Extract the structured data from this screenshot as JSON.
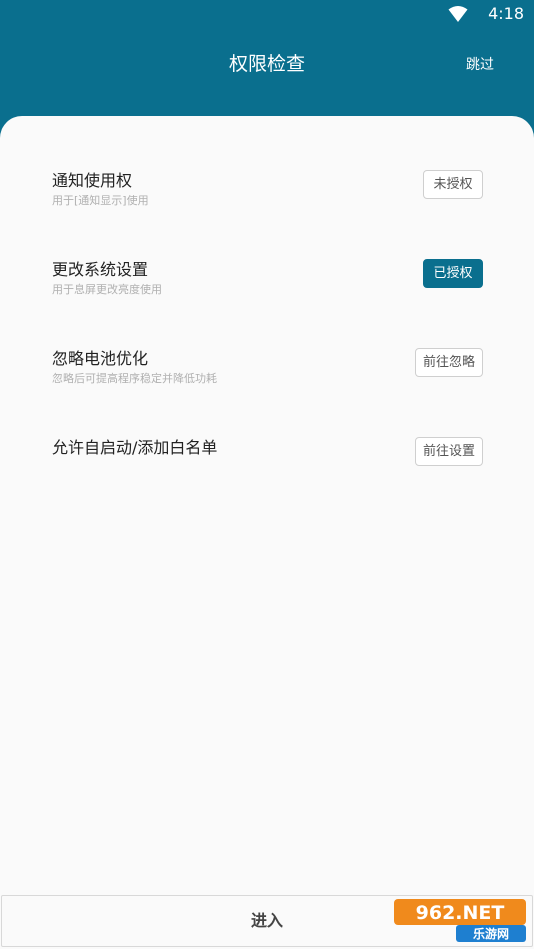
{
  "status_bar": {
    "time": "4:18",
    "wifi_icon": "wifi-icon"
  },
  "header": {
    "title": "权限检查",
    "skip_label": "跳过"
  },
  "permissions": [
    {
      "title": "通知使用权",
      "description": "用于[通知显示]使用",
      "button": "未授权",
      "granted": false
    },
    {
      "title": "更改系统设置",
      "description": "用于息屏更改亮度使用",
      "button": "已授权",
      "granted": true
    },
    {
      "title": "忽略电池优化",
      "description": "忽略后可提高程序稳定并降低功耗",
      "button": "前往忽略",
      "granted": false
    },
    {
      "title": "允许自启动/添加白名单",
      "description": "",
      "button": "前往设置",
      "granted": false
    }
  ],
  "footer": {
    "enter_label": "进入"
  },
  "watermark": {
    "logo_text": "962.NET",
    "site_name": "乐游网"
  },
  "colors": {
    "primary": "#0a6f8e",
    "card_bg": "#fafafa",
    "desc_text": "#b0b0b0"
  }
}
